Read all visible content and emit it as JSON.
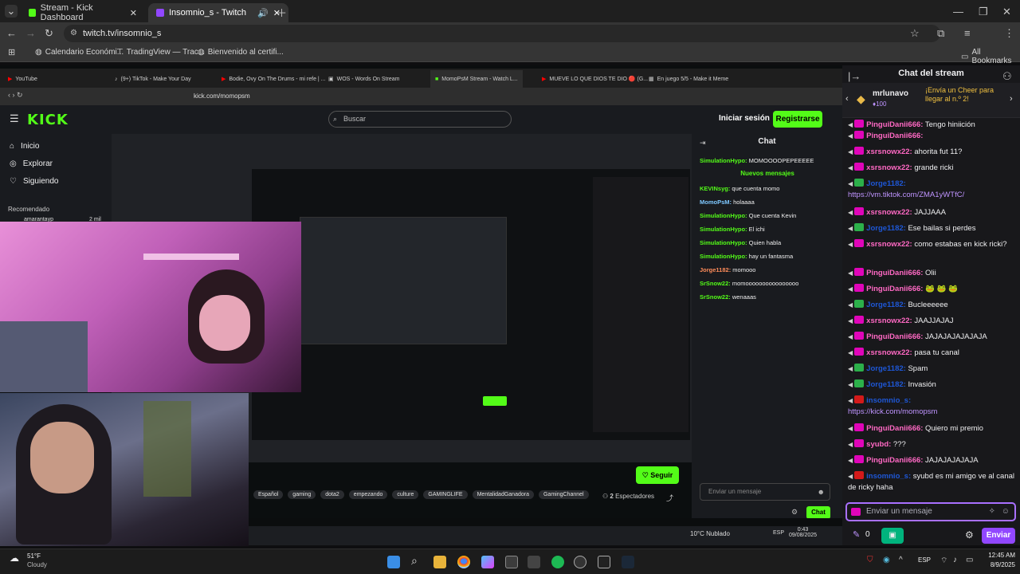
{
  "browser": {
    "tabs": [
      {
        "label": "Stream - Kick Dashboard"
      },
      {
        "label": "Insomnio_s - Twitch"
      }
    ],
    "url": "twitch.tv/insomnio_s",
    "bookmarks": [
      {
        "label": "Calendario Económi..."
      },
      {
        "label": "TradingView — Trac..."
      },
      {
        "label": "Bienvenido al certifi..."
      }
    ],
    "all_bookmarks": "All Bookmarks"
  },
  "inner_browser": {
    "tabs": [
      {
        "label": "YouTube"
      },
      {
        "label": "(9+) TikTok - Make Your Day"
      },
      {
        "label": "Bodie, Ovy On The Drums - mi refe | ..."
      },
      {
        "label": "WOS - Words On Stream"
      },
      {
        "label": "MomoPsM Stream - Watch L..."
      },
      {
        "label": "MUEVE LO QUE DIOS TE DIO 🔴 (G..."
      },
      {
        "label": "En juego 5/5 - Make it Meme"
      }
    ],
    "url": "kick.com/momopsm"
  },
  "kick": {
    "search_placeholder": "Buscar",
    "login": "Iniciar sesión",
    "register": "Registrarse",
    "nav": [
      {
        "label": "Inicio"
      },
      {
        "label": "Explorar"
      },
      {
        "label": "Siguiendo"
      }
    ],
    "recommended": "Recomendado",
    "rec_user": "amarantayp",
    "rec_count": "2 mil",
    "chat_title": "Chat",
    "new_messages": "Nuevos mensajes",
    "messages": [
      {
        "user": "SimulationHypo:",
        "text": " MOMOOOOPEPEEEEE"
      },
      {
        "user": "KEVINsyg:",
        "text": " que cuenta momo"
      },
      {
        "user": "MomoPsM:",
        "text": " holaaaa"
      },
      {
        "user": "SimulationHypo:",
        "text": " Que cuenta Kevin"
      },
      {
        "user": "SimulationHypo:",
        "text": " El ichi"
      },
      {
        "user": "SimulationHypo:",
        "text": " Quien habla"
      },
      {
        "user": "SimulationHypo:",
        "text": " hay un fantasma"
      },
      {
        "user": "Jorge1182:",
        "text": " momooo"
      },
      {
        "user": "SrSnow22:",
        "text": " momoooooooooooooooo"
      },
      {
        "user": "SrSnow22:",
        "text": " wenaaas"
      }
    ],
    "input_placeholder": "Enviar un mensaje",
    "chat_button": "Chat",
    "follow": "Seguir",
    "tags": [
      "Español",
      "gaming",
      "dota2",
      "empezando",
      "culture",
      "GAMINGLIFE",
      "MentalidadGanadora",
      "GamingChannel"
    ],
    "viewers_count": "2",
    "viewers_label": "Espectadores",
    "weather": "10°C  Nublado",
    "lang": "ESP",
    "time": "0:43",
    "date": "09/08/2025"
  },
  "twitch": {
    "chat_title": "Chat del stream",
    "pinned_user": "mrlunavo",
    "pinned_bits": "100",
    "pinned_text": "¡Envía un Cheer para llegar al n.º 2!",
    "messages": [
      {
        "user": "PinguiDanii666:",
        "text": " Tengo hiniición",
        "ut": "u1",
        "badge": "bp"
      },
      {
        "user": "PinguiDanii666:",
        "text": "",
        "ut": "u1",
        "badge": "bp"
      },
      {
        "user": "xsrsnowx22:",
        "text": " ahorita fut 11?",
        "ut": "u1",
        "badge": "bp"
      },
      {
        "user": "xsrsnowx22:",
        "text": " grande ricki",
        "ut": "u1",
        "badge": "bp"
      },
      {
        "user": "Jorge1182:",
        "text": " ",
        "ut": "u3",
        "badge": "bg",
        "link": "https://vm.tiktok.com/ZMA1yWTfC/"
      },
      {
        "user": "xsrsnowx22:",
        "text": " JAJJAAA",
        "ut": "u1",
        "badge": "bp"
      },
      {
        "user": "Jorge1182:",
        "text": " Ese bailas si perdes",
        "ut": "u3",
        "badge": "bg"
      },
      {
        "user": "xsrsnowx22:",
        "text": " como estabas en kick ricki?",
        "ut": "u1",
        "badge": "bp"
      },
      {
        "user": "PinguiDanii666:",
        "text": " Olii",
        "ut": "u1",
        "badge": "bp"
      },
      {
        "user": "PinguiDanii666:",
        "text": " 🐸 🐸 🐸",
        "ut": "u1",
        "badge": "bp"
      },
      {
        "user": "Jorge1182:",
        "text": " Bucleeeeee",
        "ut": "u3",
        "badge": "bg"
      },
      {
        "user": "xsrsnowx22:",
        "text": " JAAJJAJAJ",
        "ut": "u1",
        "badge": "bp"
      },
      {
        "user": "PinguiDanii666:",
        "text": " JAJAJAJAJAJAJA",
        "ut": "u1",
        "badge": "bp"
      },
      {
        "user": "xsrsnowx22:",
        "text": " pasa tu canal",
        "ut": "u1",
        "badge": "bp"
      },
      {
        "user": "Jorge1182:",
        "text": " Spam",
        "ut": "u3",
        "badge": "bg"
      },
      {
        "user": "Jorge1182:",
        "text": " Invasión",
        "ut": "u3",
        "badge": "bg"
      },
      {
        "user": "insomnio_s:",
        "text": " ",
        "ut": "u3",
        "badge": "br",
        "link": "https://kick.com/momopsm"
      },
      {
        "user": "PinguiDanii666:",
        "text": " Quiero mi premio",
        "ut": "u1",
        "badge": "bp"
      },
      {
        "user": "syubd:",
        "text": " ???",
        "ut": "u1",
        "badge": "bp"
      },
      {
        "user": "PinguiDanii666:",
        "text": " JAJAJAJAJAJA",
        "ut": "u1",
        "badge": "bp"
      },
      {
        "user": "insomnio_s:",
        "text": " syubd es mi amigo ve al canal de ricky haha",
        "ut": "u3",
        "badge": "br"
      }
    ],
    "input_placeholder": "Enviar un mensaje",
    "points": "0",
    "send": "Enviar"
  },
  "taskbar": {
    "weather_temp": "51°F",
    "weather_desc": "Cloudy",
    "lang": "ESP",
    "time": "12:45 AM",
    "date": "8/9/2025"
  },
  "colors": {
    "kick_green": "#53fc18",
    "twitch_purple": "#9147ff",
    "pink_user": "#ff69c4"
  }
}
